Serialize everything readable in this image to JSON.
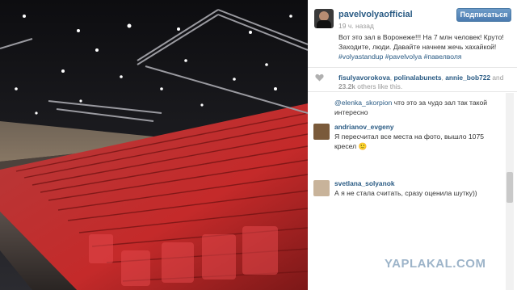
{
  "post": {
    "username": "pavelvolyaofficial",
    "follow_label": "Подписаться",
    "timestamp": "19 ч. назад",
    "caption": "Вот это зал в Воронеже!!! На 7 млн человек! Круто! Заходите, люди. Давайте начнем жечь хахайкой!",
    "hashtags": "#volyastandup #pavelvolya #павелволя"
  },
  "likes": {
    "users": [
      "fisulyavorokova",
      "polinalabunets",
      "annie_bob722"
    ],
    "separator": ", ",
    "and_label": " and",
    "count": "23.2k",
    "suffix": " others like this."
  },
  "comments": [
    {
      "username": "",
      "mention": "@elenka_skorpion",
      "text": " что это за чудо зал так такой интересно"
    },
    {
      "username": "andrianov_evgeny",
      "mention": "",
      "text": "Я пересчитал все места на фото, вышло 1075 кресел 🙂"
    },
    {
      "username": "svetlana_solyanok",
      "mention": "",
      "text": "А я не стала считать, сразу оценила шутку))"
    }
  ],
  "watermark": "YAPLAKAL.COM",
  "icons": {
    "heart": "heart-icon",
    "avatar": "avatar"
  },
  "colors": {
    "link": "#2a5b84",
    "follow_button": "#5587b9",
    "seats": "#c42a2a",
    "watermark": "#9db4c9"
  }
}
